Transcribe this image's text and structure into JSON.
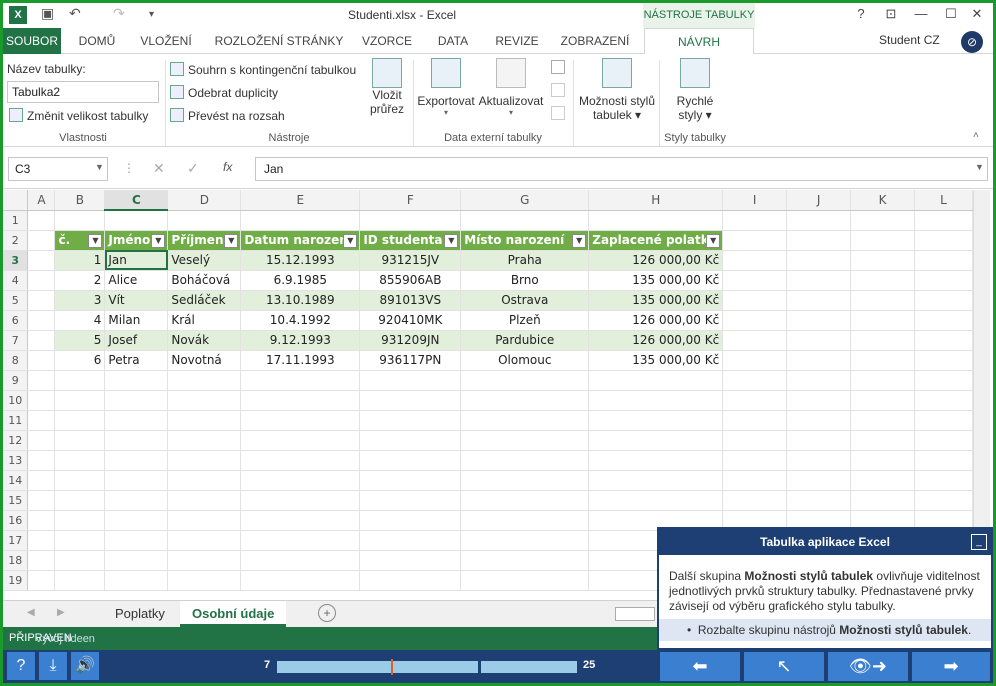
{
  "titlebar": {
    "title": "Studenti.xlsx - Excel",
    "context": "NÁSTROJE TABULKY",
    "undo": "↶",
    "redo": "↷",
    "help": "?",
    "min": "—",
    "max": "☐",
    "close": "✕",
    "restore": "⊡"
  },
  "tabs": [
    "SOUBOR",
    "DOMŮ",
    "VLOŽENÍ",
    "ROZLOŽENÍ STRÁNKY",
    "VZORCE",
    "DATA",
    "REVIZE",
    "ZOBRAZENÍ",
    "NÁVRH"
  ],
  "user": "Student CZ",
  "ribbon": {
    "name_label": "Název tabulky:",
    "name_value": "Tabulka2",
    "resize": "Změnit velikost tabulky",
    "group1": "Vlastnosti",
    "pivot": "Souhrn s kontingenční tabulkou",
    "dedupe": "Odebrat duplicity",
    "convert": "Převést na rozsah",
    "slicer1": "Vložit",
    "slicer2": "průřez",
    "group2": "Nástroje",
    "export": "Exportovat",
    "refresh": "Aktualizovat",
    "group3": "Data externí tabulky",
    "styleopts1": "Možnosti stylů",
    "styleopts2": "tabulek",
    "quick1": "Rychlé",
    "quick2": "styly",
    "group4": "Styly tabulky"
  },
  "formula": {
    "cellref": "C3",
    "value": "Jan",
    "fx": "fx"
  },
  "columns": [
    "A",
    "B",
    "C",
    "D",
    "E",
    "F",
    "G",
    "H",
    "I",
    "J",
    "K",
    "L"
  ],
  "headers": [
    "č.",
    "Jméno",
    "Příjmení",
    "Datum narození",
    "ID studenta",
    "Místo narození",
    "Zaplacené polatky"
  ],
  "rows": [
    [
      "1",
      "Jan",
      "Veselý",
      "15.12.1993",
      "931215JV",
      "Praha",
      "126 000,00 Kč"
    ],
    [
      "2",
      "Alice",
      "Boháčová",
      "6.9.1985",
      "855906AB",
      "Brno",
      "135 000,00 Kč"
    ],
    [
      "3",
      "Vít",
      "Sedláček",
      "13.10.1989",
      "891013VS",
      "Ostrava",
      "135 000,00 Kč"
    ],
    [
      "4",
      "Milan",
      "Král",
      "10.4.1992",
      "920410MK",
      "Plzeň",
      "126 000,00 Kč"
    ],
    [
      "5",
      "Josef",
      "Novák",
      "9.12.1993",
      "931209JN",
      "Pardubice",
      "126 000,00 Kč"
    ],
    [
      "6",
      "Petra",
      "Novotná",
      "17.11.1993",
      "936117PN",
      "Olomouc",
      "135 000,00 Kč"
    ]
  ],
  "sheets": [
    "Poplatky",
    "Osobní údaje"
  ],
  "status": "PŘIPRAVEN",
  "status_overlay": "Vývoj lIdeen",
  "player": {
    "start": "7",
    "end": "25",
    "progress": 0.38
  },
  "help": {
    "title": "Tabulka aplikace Excel",
    "body_pre": "Další skupina ",
    "body_bold": "Možnosti stylů tabulek",
    "body_post": " ovlivňuje viditelnost jednotlivých prvků struktury tabulky. Přednastavené prvky závisejí od výběru grafického stylu tabulky.",
    "bullet_pre": "Rozbalte skupinu nástrojů ",
    "bullet_bold": "Možnosti stylů tabulek",
    "bullet_post": "."
  },
  "colors": {
    "accent": "#217346",
    "table_header": "#70ad47",
    "band": "#e2efda",
    "player": "#1e3f73",
    "frame": "#1a9a2a"
  }
}
